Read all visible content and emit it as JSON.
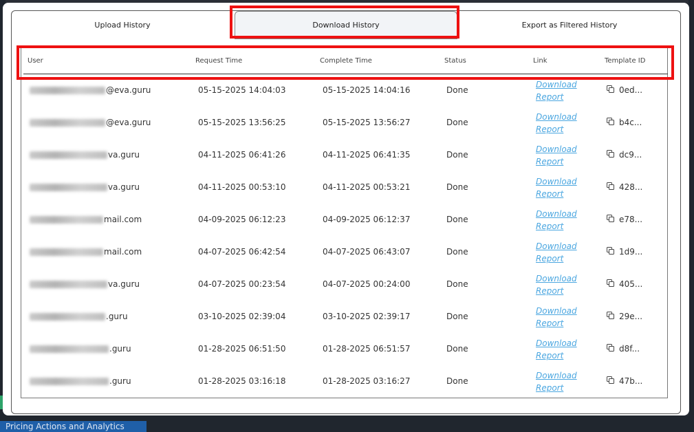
{
  "background": {
    "bottom_label": "Pricing Actions and Analytics"
  },
  "tabs": [
    {
      "label": "Upload History"
    },
    {
      "label": "Download History"
    },
    {
      "label": "Export as Filtered History"
    }
  ],
  "columns": {
    "user": "User",
    "request_time": "Request Time",
    "complete_time": "Complete Time",
    "status": "Status",
    "link": "Link",
    "template_id": "Template ID"
  },
  "link_label_1": "Download",
  "link_label_2": "Report",
  "rows": [
    {
      "user": "@eva.guru",
      "blur": 110,
      "request": "05-15-2025 14:04:03",
      "complete": "05-15-2025 14:04:16",
      "status": "Done",
      "template": "0ed..."
    },
    {
      "user": "@eva.guru",
      "blur": 110,
      "request": "05-15-2025 13:56:25",
      "complete": "05-15-2025 13:56:27",
      "status": "Done",
      "template": "b4c..."
    },
    {
      "user": "va.guru",
      "blur": 113,
      "request": "04-11-2025 06:41:26",
      "complete": "04-11-2025 06:41:35",
      "status": "Done",
      "template": "dc9..."
    },
    {
      "user": "va.guru",
      "blur": 113,
      "request": "04-11-2025 00:53:10",
      "complete": "04-11-2025 00:53:21",
      "status": "Done",
      "template": "428..."
    },
    {
      "user": "mail.com",
      "blur": 107,
      "request": "04-09-2025 06:12:23",
      "complete": "04-09-2025 06:12:37",
      "status": "Done",
      "template": "e78..."
    },
    {
      "user": "mail.com",
      "blur": 107,
      "request": "04-07-2025 06:42:54",
      "complete": "04-07-2025 06:43:07",
      "status": "Done",
      "template": "1d9..."
    },
    {
      "user": "va.guru",
      "blur": 113,
      "request": "04-07-2025 00:23:54",
      "complete": "04-07-2025 00:24:00",
      "status": "Done",
      "template": "405..."
    },
    {
      "user": ".guru",
      "blur": 110,
      "request": "03-10-2025 02:39:04",
      "complete": "03-10-2025 02:39:17",
      "status": "Done",
      "template": "29e..."
    },
    {
      "user": ".guru",
      "blur": 115,
      "request": "01-28-2025 06:51:50",
      "complete": "01-28-2025 06:51:57",
      "status": "Done",
      "template": "d8f..."
    },
    {
      "user": ".guru",
      "blur": 115,
      "request": "01-28-2025 03:16:18",
      "complete": "01-28-2025 03:16:27",
      "status": "Done",
      "template": "47b..."
    }
  ]
}
